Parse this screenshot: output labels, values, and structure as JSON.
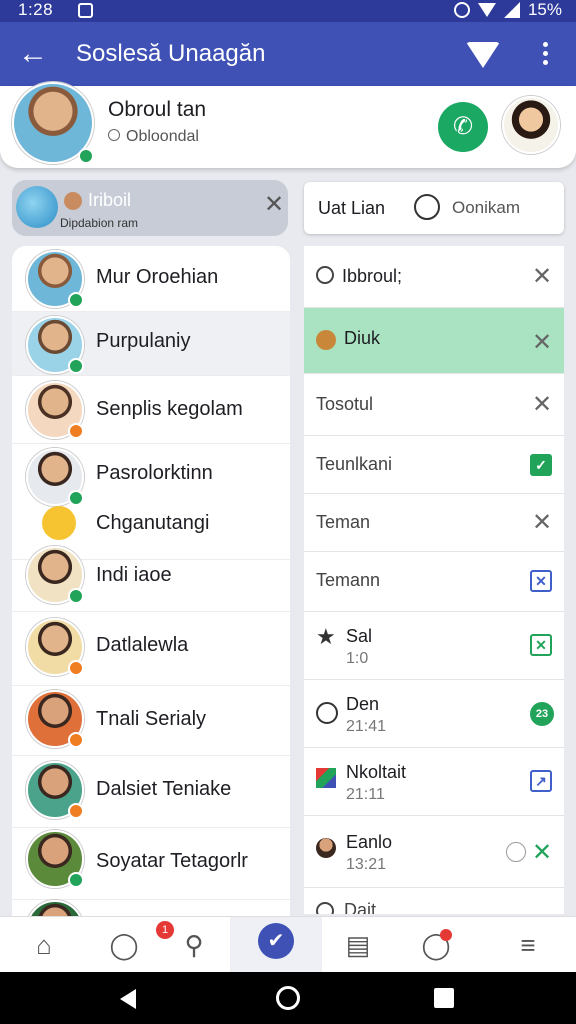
{
  "status": {
    "time": "1:28",
    "battery": "15%"
  },
  "appbar": {
    "title": "Soslesă Unaagăn"
  },
  "profile": {
    "name": "Obroul tan",
    "subtitle": "Obloondal"
  },
  "left_tab": {
    "title": "Iriboil",
    "subtitle": "Dipdabion ram"
  },
  "contacts": [
    {
      "name": "Mur Oroehian",
      "status": "#21a35a"
    },
    {
      "name": "Purpulaniy",
      "status": "#21a35a"
    },
    {
      "name": "Senplis kegolam",
      "status": "#ef7d22"
    },
    {
      "name": "Pasrolorktinn",
      "status": "#21a35a"
    },
    {
      "name": "Chganutangi",
      "status": ""
    },
    {
      "name": "Indi iaoe",
      "status": "#21a35a"
    },
    {
      "name": "Datlalewla",
      "status": "#ef7d22"
    },
    {
      "name": "Tnali Serialy",
      "status": "#ef7d22"
    },
    {
      "name": "Dalsiet Teniake",
      "status": "#ef7d22"
    },
    {
      "name": "Soyatar Tetagorlr",
      "status": "#21a35a"
    }
  ],
  "right_head": {
    "left": "Uat Lian",
    "right": "Oonikam"
  },
  "tasks": [
    {
      "label": "Ibbroul;",
      "sub": ""
    },
    {
      "label": "Diuk",
      "sub": ""
    },
    {
      "label": "Tosotul",
      "sub": ""
    },
    {
      "label": "Teunlkani",
      "sub": ""
    },
    {
      "label": "Teman",
      "sub": ""
    },
    {
      "label": "Temann",
      "sub": ""
    },
    {
      "label": "Sal",
      "sub": "1:0"
    },
    {
      "label": "Den",
      "sub": "21:41"
    },
    {
      "label": "Nkoltait",
      "sub": "21:11"
    },
    {
      "label": "Eanlo",
      "sub": "13:21"
    },
    {
      "label": "Dait",
      "sub": ""
    }
  ],
  "bottom_nav": {
    "badge1": "1",
    "badge2": "1"
  },
  "colors": {
    "primary": "#3f51b5",
    "accent_green": "#1aa862",
    "highlight": "#a9e3c1"
  }
}
